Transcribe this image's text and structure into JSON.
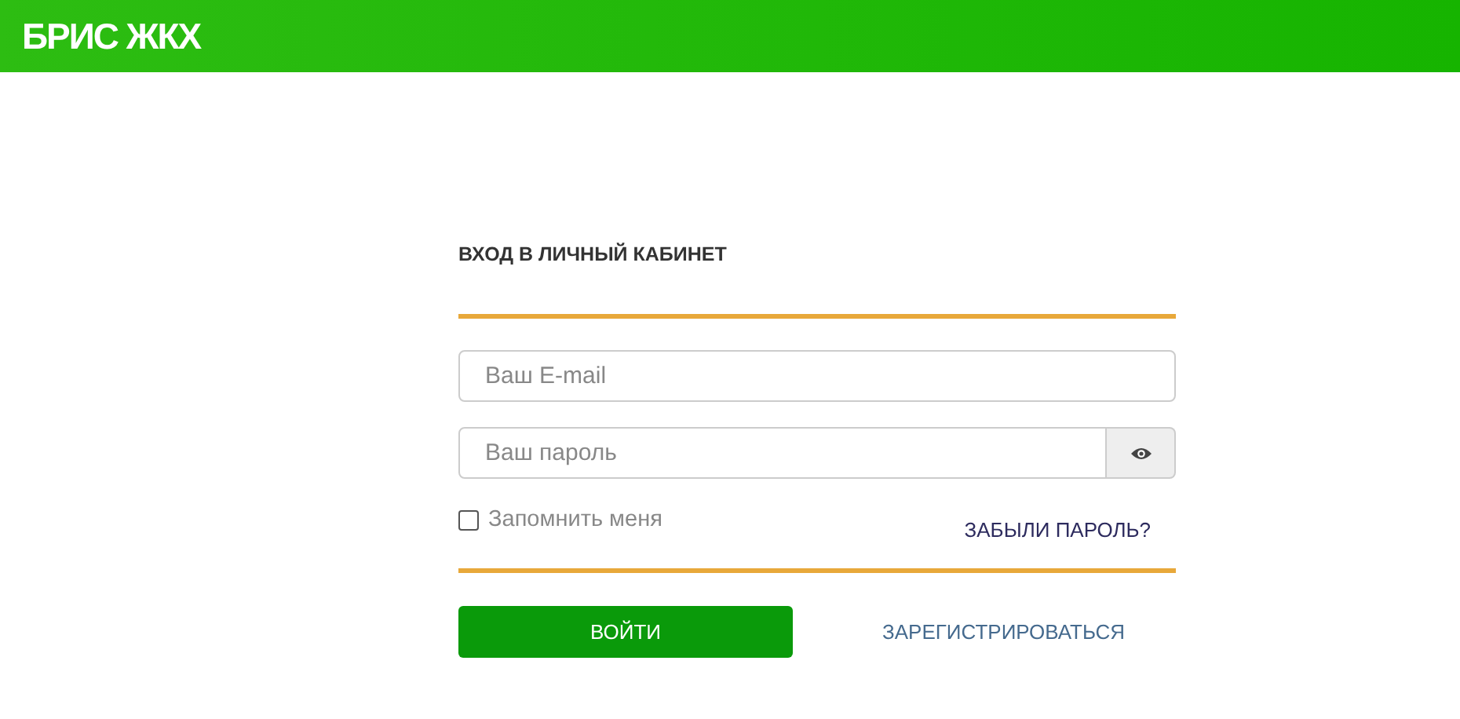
{
  "header": {
    "logo": "БРИС ЖКХ"
  },
  "login": {
    "title": "ВХОД В ЛИЧНЫЙ КАБИНЕТ",
    "email": {
      "placeholder": "Ваш E-mail"
    },
    "password": {
      "placeholder": "Ваш пароль"
    },
    "remember": {
      "label": "Запомнить меня",
      "checked": false
    },
    "forgot": "ЗАБЫЛИ ПАРОЛЬ?",
    "submit": "ВОЙТИ",
    "register": "ЗАРЕГИСТРИРОВАТЬСЯ"
  }
}
